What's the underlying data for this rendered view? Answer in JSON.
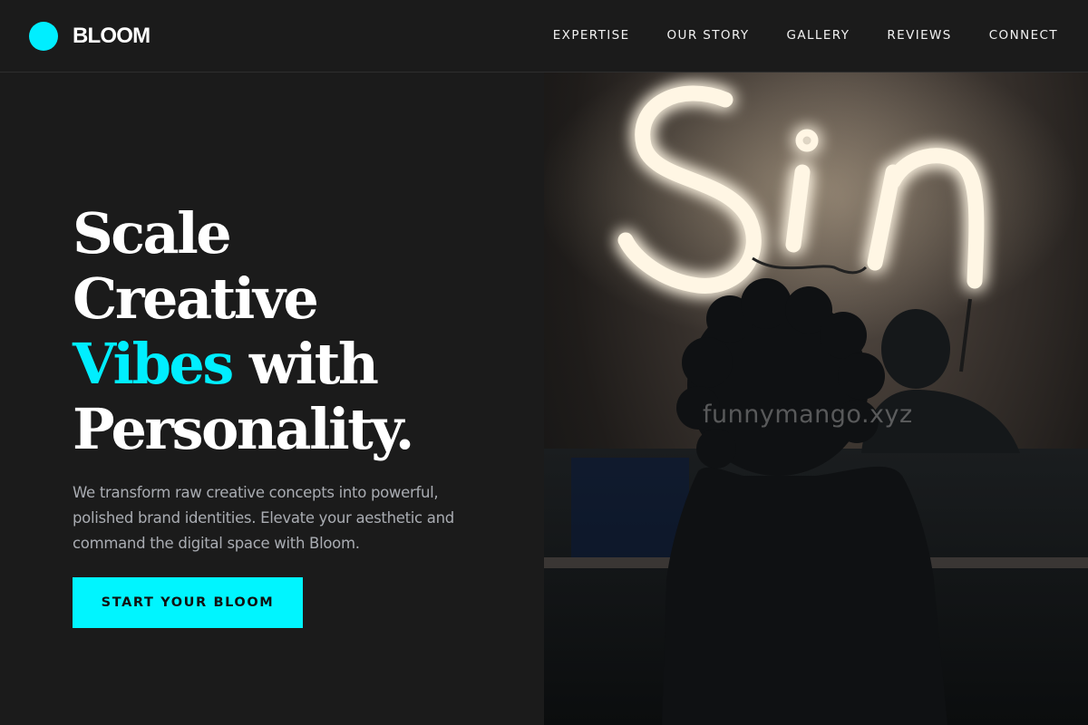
{
  "brand": {
    "name": "BLOOM",
    "accent_color": "#00eeff"
  },
  "nav": {
    "items": [
      {
        "label": "EXPERTISE"
      },
      {
        "label": "OUR STORY"
      },
      {
        "label": "GALLERY"
      },
      {
        "label": "REVIEWS"
      },
      {
        "label": "CONNECT"
      }
    ]
  },
  "hero": {
    "headline_line1": "Scale",
    "headline_line2": "Creative",
    "headline_accent": "Vibes",
    "headline_line3_rest": " with",
    "headline_line4": "Personality.",
    "subtext": "We transform raw creative concepts into powerful, polished brand identities. Elevate your aesthetic and command the digital space with Bloom.",
    "cta_label": "START YOUR BLOOM"
  },
  "image": {
    "neon_sign_text": "Sin",
    "watermark": "funnymango.xyz"
  }
}
